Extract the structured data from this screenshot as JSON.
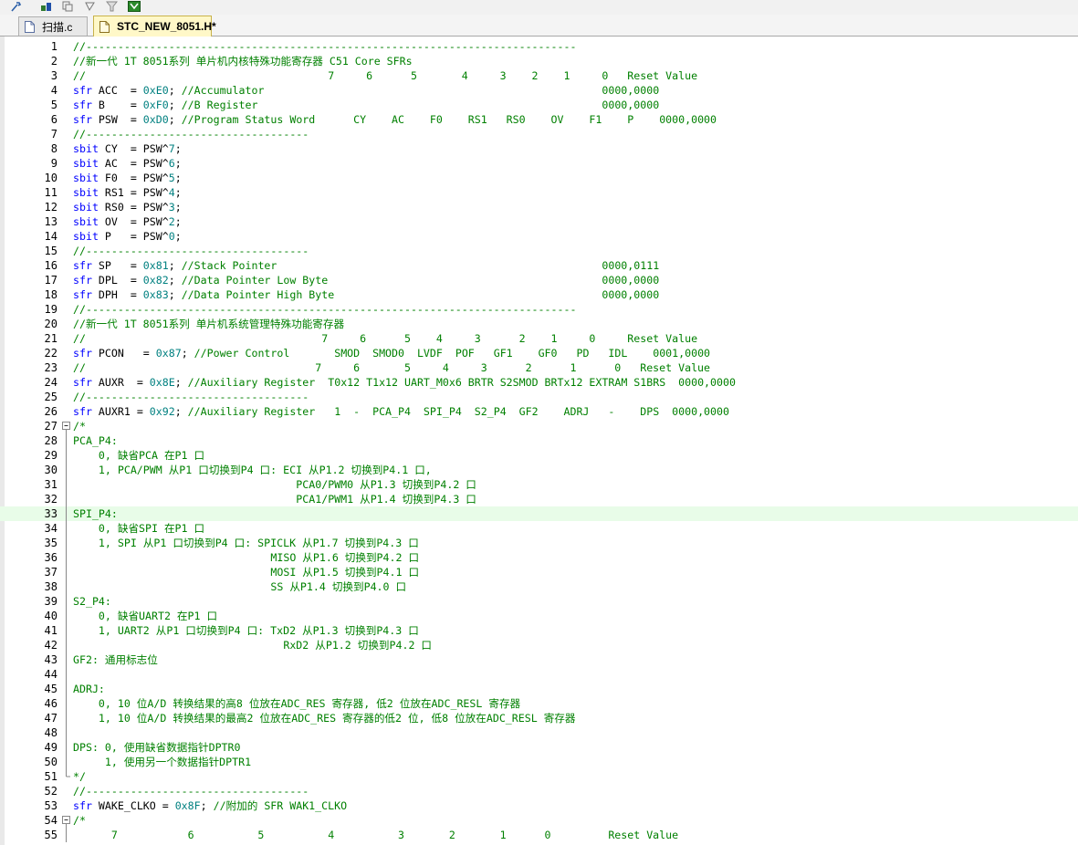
{
  "colors": {
    "keyword": "#0000ff",
    "comment": "#008000",
    "number": "#008080",
    "current_line": "#e8fce8",
    "active_tab": "#fff8c8"
  },
  "toolbar": {
    "icons": [
      "wrench-icon",
      "build-icon",
      "copy-icon",
      "insert-icon",
      "filter-icon",
      "download-icon"
    ]
  },
  "tabs": [
    {
      "label": "扫描.c",
      "active": false
    },
    {
      "label": "STC_NEW_8051.H*",
      "active": true
    }
  ],
  "editor": {
    "current_line": 33,
    "lines": [
      {
        "n": "1",
        "fold": "",
        "tokens": [
          [
            "cm",
            "//-----------------------------------------------------------------------------"
          ]
        ]
      },
      {
        "n": "2",
        "fold": "",
        "tokens": [
          [
            "cm",
            "//新一代 1T 8051系列 单片机内核特殊功能寄存器 C51 Core SFRs"
          ]
        ]
      },
      {
        "n": "3",
        "fold": "",
        "tokens": [
          [
            "cm",
            "//                                      7     6      5       4     3    2    1     0   Reset Value"
          ]
        ]
      },
      {
        "n": "4",
        "fold": "",
        "tokens": [
          [
            "kw",
            "sfr"
          ],
          [
            "pl",
            " ACC  = "
          ],
          [
            "num",
            "0xE0"
          ],
          [
            "pl",
            "; "
          ],
          [
            "cm",
            "//Accumulator                                                     0000,0000"
          ]
        ]
      },
      {
        "n": "5",
        "fold": "",
        "tokens": [
          [
            "kw",
            "sfr"
          ],
          [
            "pl",
            " B    = "
          ],
          [
            "num",
            "0xF0"
          ],
          [
            "pl",
            "; "
          ],
          [
            "cm",
            "//B Register                                                      0000,0000"
          ]
        ]
      },
      {
        "n": "6",
        "fold": "",
        "tokens": [
          [
            "kw",
            "sfr"
          ],
          [
            "pl",
            " PSW  = "
          ],
          [
            "num",
            "0xD0"
          ],
          [
            "pl",
            "; "
          ],
          [
            "cm",
            "//Program Status Word      CY    AC    F0    RS1   RS0    OV    F1    P    0000,0000"
          ]
        ]
      },
      {
        "n": "7",
        "fold": "",
        "tokens": [
          [
            "cm",
            "//-----------------------------------"
          ]
        ]
      },
      {
        "n": "8",
        "fold": "",
        "tokens": [
          [
            "kw",
            "sbit"
          ],
          [
            "pl",
            " CY  = PSW^"
          ],
          [
            "num",
            "7"
          ],
          [
            "pl",
            ";"
          ]
        ]
      },
      {
        "n": "9",
        "fold": "",
        "tokens": [
          [
            "kw",
            "sbit"
          ],
          [
            "pl",
            " AC  = PSW^"
          ],
          [
            "num",
            "6"
          ],
          [
            "pl",
            ";"
          ]
        ]
      },
      {
        "n": "10",
        "fold": "",
        "tokens": [
          [
            "kw",
            "sbit"
          ],
          [
            "pl",
            " F0  = PSW^"
          ],
          [
            "num",
            "5"
          ],
          [
            "pl",
            ";"
          ]
        ]
      },
      {
        "n": "11",
        "fold": "",
        "tokens": [
          [
            "kw",
            "sbit"
          ],
          [
            "pl",
            " RS1 = PSW^"
          ],
          [
            "num",
            "4"
          ],
          [
            "pl",
            ";"
          ]
        ]
      },
      {
        "n": "12",
        "fold": "",
        "tokens": [
          [
            "kw",
            "sbit"
          ],
          [
            "pl",
            " RS0 = PSW^"
          ],
          [
            "num",
            "3"
          ],
          [
            "pl",
            ";"
          ]
        ]
      },
      {
        "n": "13",
        "fold": "",
        "tokens": [
          [
            "kw",
            "sbit"
          ],
          [
            "pl",
            " OV  = PSW^"
          ],
          [
            "num",
            "2"
          ],
          [
            "pl",
            ";"
          ]
        ]
      },
      {
        "n": "14",
        "fold": "",
        "tokens": [
          [
            "kw",
            "sbit"
          ],
          [
            "pl",
            " P   = PSW^"
          ],
          [
            "num",
            "0"
          ],
          [
            "pl",
            ";"
          ]
        ]
      },
      {
        "n": "15",
        "fold": "",
        "tokens": [
          [
            "cm",
            "//-----------------------------------"
          ]
        ]
      },
      {
        "n": "16",
        "fold": "",
        "tokens": [
          [
            "kw",
            "sfr"
          ],
          [
            "pl",
            " SP   = "
          ],
          [
            "num",
            "0x81"
          ],
          [
            "pl",
            "; "
          ],
          [
            "cm",
            "//Stack Pointer                                                   0000,0111"
          ]
        ]
      },
      {
        "n": "17",
        "fold": "",
        "tokens": [
          [
            "kw",
            "sfr"
          ],
          [
            "pl",
            " DPL  = "
          ],
          [
            "num",
            "0x82"
          ],
          [
            "pl",
            "; "
          ],
          [
            "cm",
            "//Data Pointer Low Byte                                           0000,0000"
          ]
        ]
      },
      {
        "n": "18",
        "fold": "",
        "tokens": [
          [
            "kw",
            "sfr"
          ],
          [
            "pl",
            " DPH  = "
          ],
          [
            "num",
            "0x83"
          ],
          [
            "pl",
            "; "
          ],
          [
            "cm",
            "//Data Pointer High Byte                                          0000,0000"
          ]
        ]
      },
      {
        "n": "19",
        "fold": "",
        "tokens": [
          [
            "cm",
            "//-----------------------------------------------------------------------------"
          ]
        ]
      },
      {
        "n": "20",
        "fold": "",
        "tokens": [
          [
            "cm",
            "//新一代 1T 8051系列 单片机系统管理特殊功能寄存器"
          ]
        ]
      },
      {
        "n": "21",
        "fold": "",
        "tokens": [
          [
            "cm",
            "//                                     7     6      5    4     3      2    1     0     Reset Value"
          ]
        ]
      },
      {
        "n": "22",
        "fold": "",
        "tokens": [
          [
            "kw",
            "sfr"
          ],
          [
            "pl",
            " PCON   = "
          ],
          [
            "num",
            "0x87"
          ],
          [
            "pl",
            "; "
          ],
          [
            "cm",
            "//Power Control       SMOD  SMOD0  LVDF  POF   GF1    GF0   PD   IDL    0001,0000"
          ]
        ]
      },
      {
        "n": "23",
        "fold": "",
        "tokens": [
          [
            "cm",
            "//                                    7     6       5     4     3      2      1      0   Reset Value"
          ]
        ]
      },
      {
        "n": "24",
        "fold": "",
        "tokens": [
          [
            "kw",
            "sfr"
          ],
          [
            "pl",
            " AUXR  = "
          ],
          [
            "num",
            "0x8E"
          ],
          [
            "pl",
            "; "
          ],
          [
            "cm",
            "//Auxiliary Register  T0x12 T1x12 UART_M0x6 BRTR S2SMOD BRTx12 EXTRAM S1BRS  0000,0000"
          ]
        ]
      },
      {
        "n": "25",
        "fold": "",
        "tokens": [
          [
            "cm",
            "//-----------------------------------"
          ]
        ]
      },
      {
        "n": "26",
        "fold": "",
        "tokens": [
          [
            "kw",
            "sfr"
          ],
          [
            "pl",
            " AUXR1 = "
          ],
          [
            "num",
            "0x92"
          ],
          [
            "pl",
            "; "
          ],
          [
            "cm",
            "//Auxiliary Register   1  -  PCA_P4  SPI_P4  S2_P4  GF2    ADRJ   -    DPS  0000,0000"
          ]
        ]
      },
      {
        "n": "27",
        "fold": "open",
        "tokens": [
          [
            "cm",
            "/*"
          ]
        ]
      },
      {
        "n": "28",
        "fold": "bar",
        "tokens": [
          [
            "cm",
            "PCA_P4:"
          ]
        ]
      },
      {
        "n": "29",
        "fold": "bar",
        "tokens": [
          [
            "cm",
            "    0, 缺省PCA 在P1 口"
          ]
        ]
      },
      {
        "n": "30",
        "fold": "bar",
        "tokens": [
          [
            "cm",
            "    1, PCA/PWM 从P1 口切换到P4 口: ECI 从P1.2 切换到P4.1 口,"
          ]
        ]
      },
      {
        "n": "31",
        "fold": "bar",
        "tokens": [
          [
            "cm",
            "                                   PCA0/PWM0 从P1.3 切换到P4.2 口"
          ]
        ]
      },
      {
        "n": "32",
        "fold": "bar",
        "tokens": [
          [
            "cm",
            "                                   PCA1/PWM1 从P1.4 切换到P4.3 口"
          ]
        ]
      },
      {
        "n": "33",
        "fold": "bar",
        "tokens": [
          [
            "cm",
            "SPI_P4:"
          ]
        ]
      },
      {
        "n": "34",
        "fold": "bar",
        "tokens": [
          [
            "cm",
            "    0, 缺省SPI 在P1 口"
          ]
        ]
      },
      {
        "n": "35",
        "fold": "bar",
        "tokens": [
          [
            "cm",
            "    1, SPI 从P1 口切换到P4 口: SPICLK 从P1.7 切换到P4.3 口"
          ]
        ]
      },
      {
        "n": "36",
        "fold": "bar",
        "tokens": [
          [
            "cm",
            "                               MISO 从P1.6 切换到P4.2 口"
          ]
        ]
      },
      {
        "n": "37",
        "fold": "bar",
        "tokens": [
          [
            "cm",
            "                               MOSI 从P1.5 切换到P4.1 口"
          ]
        ]
      },
      {
        "n": "38",
        "fold": "bar",
        "tokens": [
          [
            "cm",
            "                               SS 从P1.4 切换到P4.0 口"
          ]
        ]
      },
      {
        "n": "39",
        "fold": "bar",
        "tokens": [
          [
            "cm",
            "S2_P4:"
          ]
        ]
      },
      {
        "n": "40",
        "fold": "bar",
        "tokens": [
          [
            "cm",
            "    0, 缺省UART2 在P1 口"
          ]
        ]
      },
      {
        "n": "41",
        "fold": "bar",
        "tokens": [
          [
            "cm",
            "    1, UART2 从P1 口切换到P4 口: TxD2 从P1.3 切换到P4.3 口"
          ]
        ]
      },
      {
        "n": "42",
        "fold": "bar",
        "tokens": [
          [
            "cm",
            "                                 RxD2 从P1.2 切换到P4.2 口"
          ]
        ]
      },
      {
        "n": "43",
        "fold": "bar",
        "tokens": [
          [
            "cm",
            "GF2: 通用标志位"
          ]
        ]
      },
      {
        "n": "44",
        "fold": "bar",
        "tokens": []
      },
      {
        "n": "45",
        "fold": "bar",
        "tokens": [
          [
            "cm",
            "ADRJ:"
          ]
        ]
      },
      {
        "n": "46",
        "fold": "bar",
        "tokens": [
          [
            "cm",
            "    0, 10 位A/D 转换结果的高8 位放在ADC_RES 寄存器, 低2 位放在ADC_RESL 寄存器"
          ]
        ]
      },
      {
        "n": "47",
        "fold": "bar",
        "tokens": [
          [
            "cm",
            "    1, 10 位A/D 转换结果的最高2 位放在ADC_RES 寄存器的低2 位, 低8 位放在ADC_RESL 寄存器"
          ]
        ]
      },
      {
        "n": "48",
        "fold": "bar",
        "tokens": []
      },
      {
        "n": "49",
        "fold": "bar",
        "tokens": [
          [
            "cm",
            "DPS: 0, 使用缺省数据指针DPTR0"
          ]
        ]
      },
      {
        "n": "50",
        "fold": "bar",
        "tokens": [
          [
            "cm",
            "     1, 使用另一个数据指针DPTR1"
          ]
        ]
      },
      {
        "n": "51",
        "fold": "end",
        "tokens": [
          [
            "cm",
            "*/"
          ]
        ]
      },
      {
        "n": "52",
        "fold": "",
        "tokens": [
          [
            "cm",
            "//-----------------------------------"
          ]
        ]
      },
      {
        "n": "53",
        "fold": "",
        "tokens": [
          [
            "kw",
            "sfr"
          ],
          [
            "pl",
            " WAKE_CLKO = "
          ],
          [
            "num",
            "0x8F"
          ],
          [
            "pl",
            "; "
          ],
          [
            "cm",
            "//附加的 SFR WAK1_CLKO"
          ]
        ]
      },
      {
        "n": "54",
        "fold": "open",
        "tokens": [
          [
            "cm",
            "/*"
          ]
        ]
      },
      {
        "n": "55",
        "fold": "bar",
        "tokens": [
          [
            "cm",
            "      7           6          5          4          3       2       1      0         Reset Value"
          ]
        ]
      }
    ]
  }
}
